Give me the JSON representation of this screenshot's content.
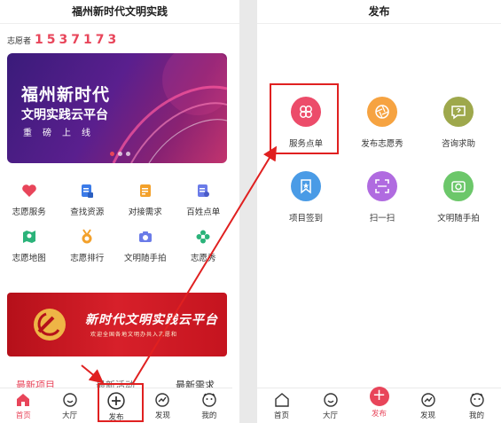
{
  "left": {
    "header_title": "福州新时代文明实践",
    "volunteer_label": "志愿者",
    "volunteer_number": "1537173",
    "banner": {
      "line1": "福州新时代",
      "line2": "文明实践云平台",
      "line3": "重磅上线",
      "slide_count": 3,
      "active_slide": 1
    },
    "grid": [
      {
        "label": "志愿服务",
        "icon": "heart-icon",
        "color": "#e8455a"
      },
      {
        "label": "查找资源",
        "icon": "document-icon",
        "color": "#3b7be8"
      },
      {
        "label": "对接需求",
        "icon": "note-icon",
        "color": "#f3a12b"
      },
      {
        "label": "百姓点单",
        "icon": "person-list-icon",
        "color": "#6a7be8"
      },
      {
        "label": "志愿地图",
        "icon": "map-icon",
        "color": "#2bb37a"
      },
      {
        "label": "志愿排行",
        "icon": "medal-icon",
        "color": "#f3a12b"
      },
      {
        "label": "文明随手拍",
        "icon": "camera-icon",
        "color": "#6a7be8"
      },
      {
        "label": "志愿秀",
        "icon": "flower-icon",
        "color": "#2bb37a"
      }
    ],
    "ad": {
      "title": "新时代文明实践云平台",
      "subtitle": "欢迎全国各地文明办共入志愿和"
    },
    "tabs": [
      {
        "label": "最新项目",
        "active": true
      },
      {
        "label": "最新活动",
        "active": false
      },
      {
        "label": "最新需求",
        "active": false
      }
    ],
    "nav": [
      {
        "label": "首页",
        "icon": "home-icon",
        "active": true
      },
      {
        "label": "大厅",
        "icon": "smile-icon",
        "active": false
      },
      {
        "label": "发布",
        "icon": "plus-icon",
        "active": false
      },
      {
        "label": "发现",
        "icon": "trend-icon",
        "active": false
      },
      {
        "label": "我的",
        "icon": "face-icon",
        "active": false
      }
    ]
  },
  "right": {
    "header_title": "发布",
    "grid": [
      {
        "label": "服务点单",
        "icon": "clover-icon",
        "color": "#ec4c6a",
        "selected": true
      },
      {
        "label": "发布志愿秀",
        "icon": "aperture-icon",
        "color": "#f6a341",
        "selected": false
      },
      {
        "label": "咨询求助",
        "icon": "question-bubble-icon",
        "color": "#9ea84c",
        "selected": false
      },
      {
        "label": "项目签到",
        "icon": "bookmark-star-icon",
        "color": "#4a9be6",
        "selected": false
      },
      {
        "label": "扫一扫",
        "icon": "scan-icon",
        "color": "#b06be0",
        "selected": false
      },
      {
        "label": "文明随手拍",
        "icon": "photo-icon",
        "color": "#6cc76a",
        "selected": false
      }
    ],
    "nav": [
      {
        "label": "首页",
        "icon": "home-outline-icon",
        "active": false
      },
      {
        "label": "大厅",
        "icon": "smile-icon",
        "active": false
      },
      {
        "label": "发布",
        "icon": "plus-icon",
        "active": true
      },
      {
        "label": "发现",
        "icon": "trend-icon",
        "active": false
      },
      {
        "label": "我的",
        "icon": "face-icon",
        "active": false
      }
    ]
  },
  "colors": {
    "accent": "#e8455a",
    "highlight": "#e02020"
  }
}
